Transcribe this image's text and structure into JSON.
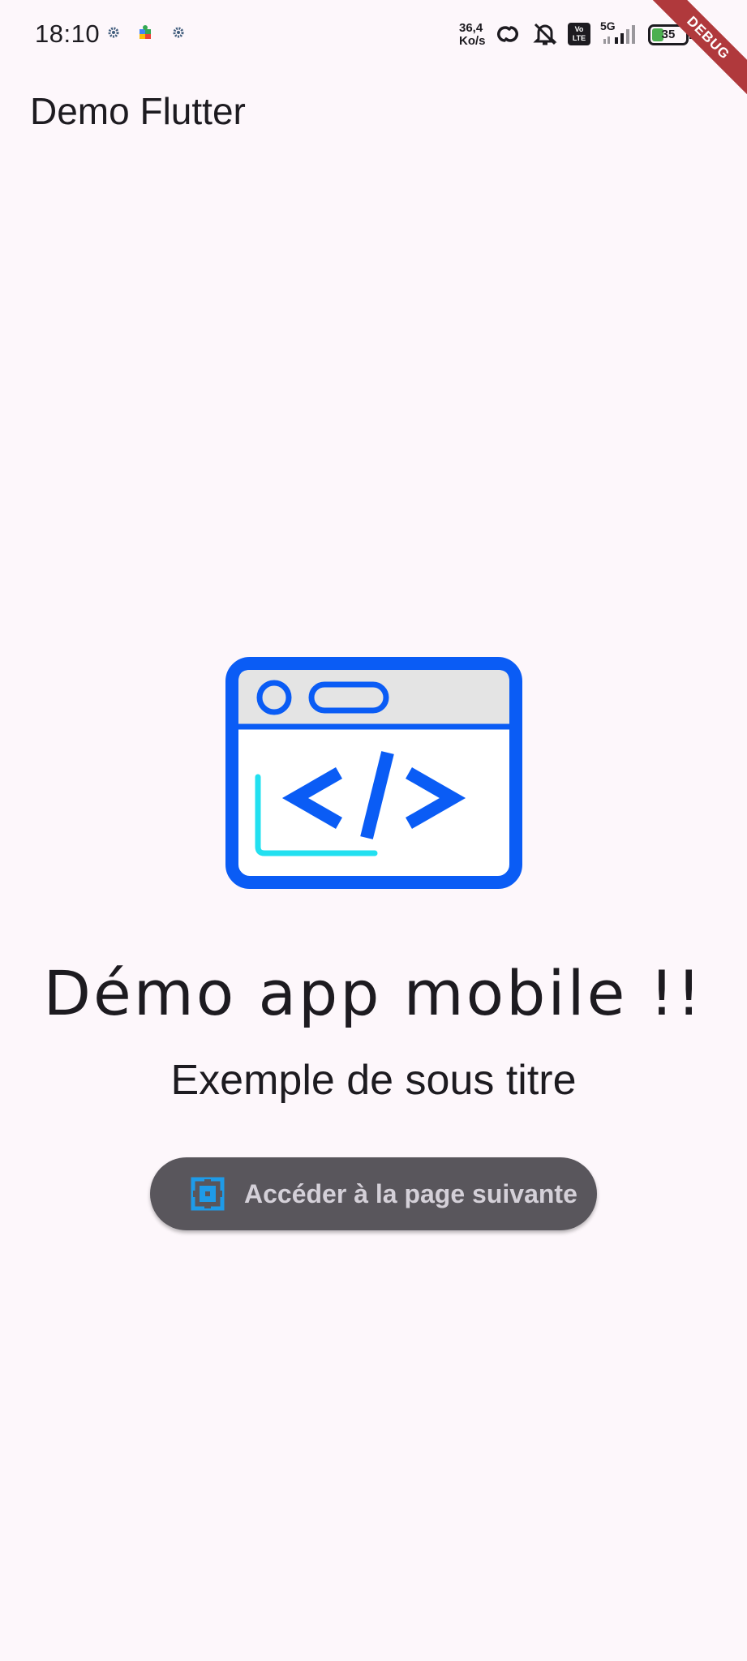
{
  "status_bar": {
    "time": "18:10",
    "net_speed_value": "36,4",
    "net_speed_unit": "Ko/s",
    "volte_label_top": "Vo",
    "volte_label_bottom": "LTE",
    "network_type": "5G",
    "battery_level": "35",
    "left_icons": [
      "settings-gear-icon",
      "puzzle-app-icon",
      "settings-gear-icon"
    ],
    "right_icons": [
      "hotspot-link-icon",
      "bell-muted-icon",
      "volte-icon",
      "signal-icon",
      "battery-icon"
    ]
  },
  "debug_banner": {
    "label": "DEBUG",
    "color": "#b0393c"
  },
  "app_bar": {
    "title": "Demo Flutter"
  },
  "hero": {
    "icon": "code-browser-window-icon",
    "colors": {
      "primary": "#0a5cf5",
      "accent": "#22e0f0",
      "header_fill": "#e4e4e4"
    }
  },
  "main": {
    "title": "Démo app mobile !!",
    "subtitle": "Exemple de sous titre"
  },
  "next_button": {
    "label": "Accéder à la page suivante",
    "icon": "puzzle-frame-icon",
    "background": "#59565c",
    "icon_color": "#1e9be8"
  }
}
